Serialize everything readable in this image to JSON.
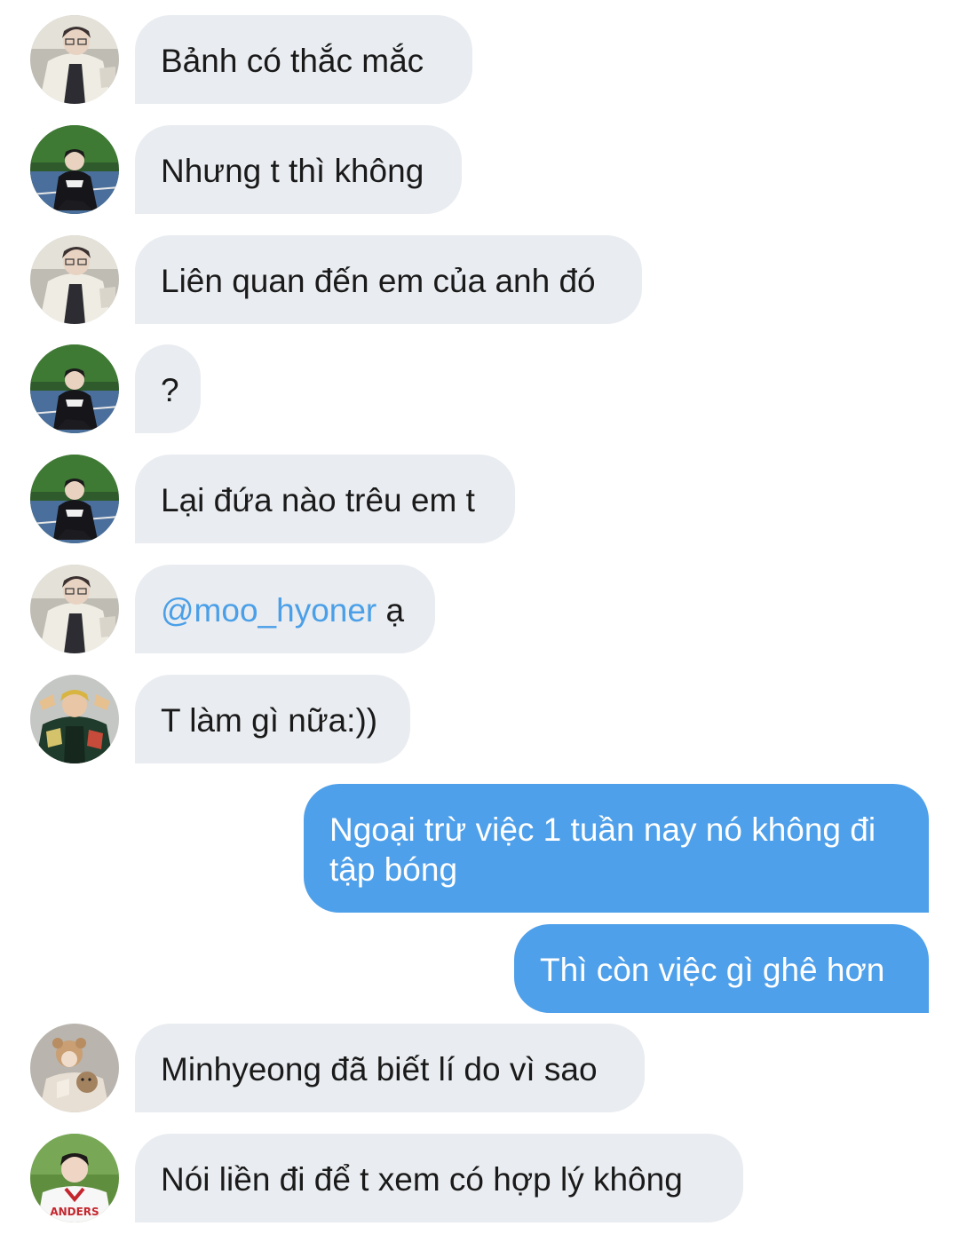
{
  "colors": {
    "incoming_bubble": "#e9ecf0",
    "outgoing_bubble": "#4fa0ea",
    "mention": "#4a9fe8",
    "background": "#ffffff"
  },
  "messages": [
    {
      "direction": "incoming",
      "avatar": "avatar-cream-jacket",
      "text": "Bảnh có thắc mắc"
    },
    {
      "direction": "incoming",
      "avatar": "avatar-court-boy",
      "text": "Nhưng t thì không"
    },
    {
      "direction": "incoming",
      "avatar": "avatar-cream-jacket",
      "text": "Liên quan đến em của anh đó"
    },
    {
      "direction": "incoming",
      "avatar": "avatar-court-boy",
      "text": "?"
    },
    {
      "direction": "incoming",
      "avatar": "avatar-court-boy",
      "text": "Lại đứa nào trêu em t"
    },
    {
      "direction": "incoming",
      "avatar": "avatar-cream-jacket",
      "mention": "@moo_hyoner",
      "text": " ạ"
    },
    {
      "direction": "incoming",
      "avatar": "avatar-varsity-jacket",
      "text": "T làm gì nữa:))"
    },
    {
      "direction": "outgoing",
      "text": "Ngoại trừ việc 1 tuần nay nó không đi tập bóng"
    },
    {
      "direction": "outgoing",
      "text": "Thì còn việc gì ghê hơn"
    },
    {
      "direction": "incoming",
      "avatar": "avatar-bear-hat",
      "text": "Minhyeong đã biết lí do vì sao"
    },
    {
      "direction": "incoming",
      "avatar": "avatar-baseball-jersey",
      "text": "Nói liền đi để t xem có hợp lý không"
    }
  ]
}
